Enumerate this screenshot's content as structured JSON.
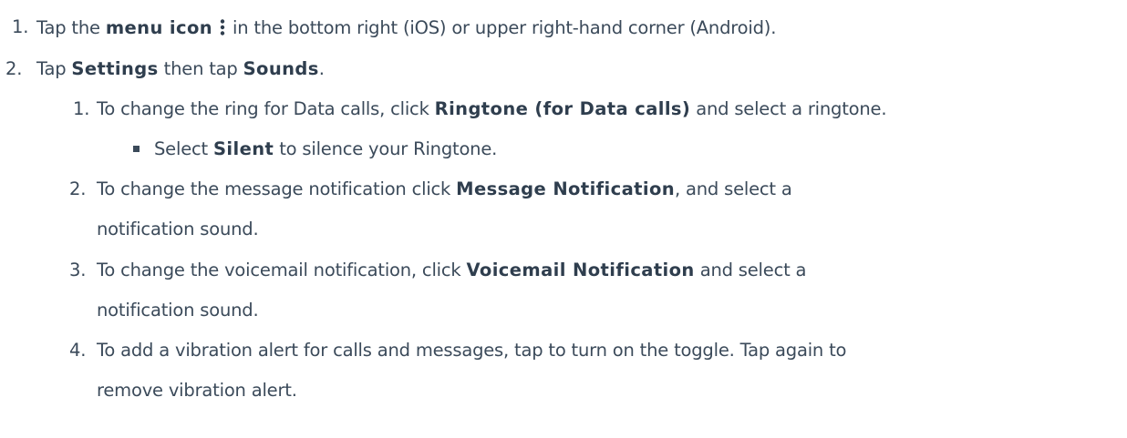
{
  "steps": [
    {
      "num": "1.",
      "t1": "Tap the ",
      "k1": "menu icon",
      "icon": "vertical-ellipsis-icon",
      "t2": "in the bottom right (iOS) or upper right-hand corner (Android)."
    },
    {
      "num": "2.",
      "t1": "Tap ",
      "k1": "Settings",
      "t2": " then tap ",
      "k2": "Sounds",
      "t3": "."
    }
  ],
  "substeps": [
    {
      "num": "1.",
      "t1": "To change the ring for Data calls, click ",
      "k1": "Ringtone (for Data calls)",
      "t2": " and select a ringtone.",
      "bullet": {
        "t1": "Select ",
        "k1": "Silent",
        "t2": " to silence your Ringtone."
      }
    },
    {
      "num": "2.",
      "line1_t1": "To change the message notification click ",
      "line1_k1": "Message Notification",
      "line1_t2": ", and select a",
      "line2": "notification sound."
    },
    {
      "num": "3.",
      "line1_t1": "To change the voicemail notification, click ",
      "line1_k1": "Voicemail Notification",
      "line1_t2": " and select a",
      "line2": "notification sound."
    },
    {
      "num": "4.",
      "line1": "To add a vibration alert for calls and messages, tap to turn on the toggle. Tap again to",
      "line2": "remove vibration alert."
    }
  ]
}
